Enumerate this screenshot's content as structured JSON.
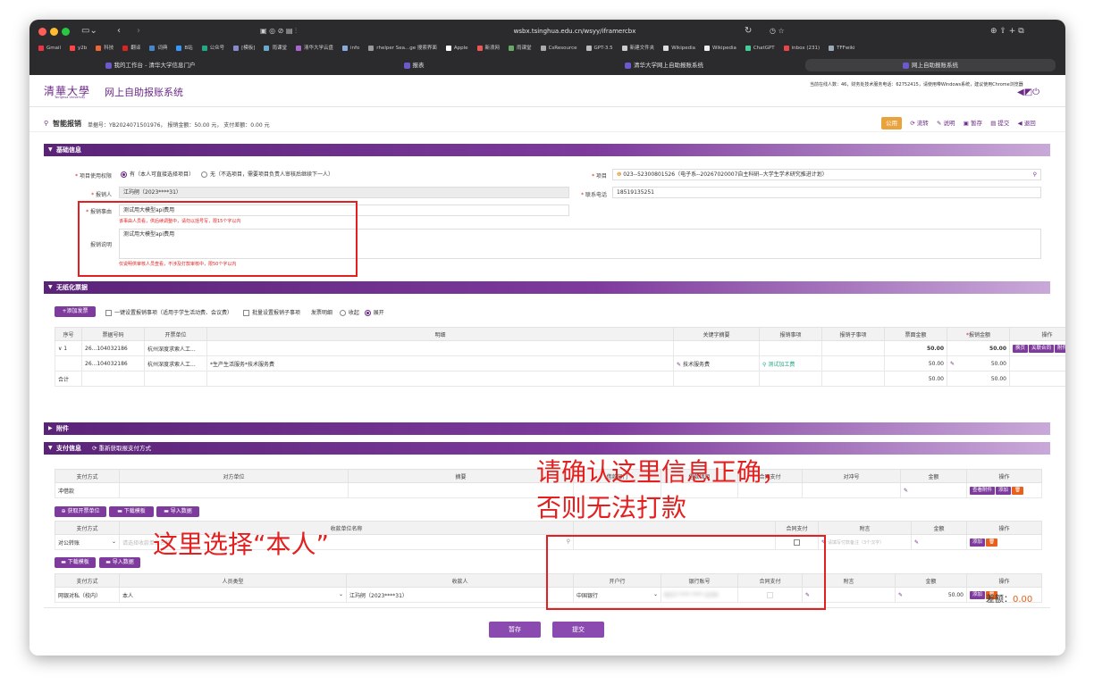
{
  "browser": {
    "url": "wsbx.tsinghua.edu.cn/wsyy/iframercbx",
    "bookmarks": [
      "Gmail",
      "y2b",
      "科技",
      "翻译",
      "词典",
      "B站",
      "公众号",
      "[模板]",
      "雨课堂",
      "清华大学云盘",
      "info",
      "rhelper Sea...ge 搜索界面",
      "Apple",
      "新浪网",
      "雨课堂",
      "CsResource",
      "GPT-3.5",
      "新建文件夹",
      "Wikipedia",
      "Wikipedia",
      "ChatGPT",
      "inbox (231)",
      "TFFwiki"
    ],
    "tabs": [
      "我的工作台 - 清华大学信息门户",
      "报表",
      "清华大学网上自助报账系统",
      "网上自助报账系统"
    ]
  },
  "header": {
    "logo": "清華大學",
    "logo_sub": "Tsinghua University",
    "title": "网上自助报账系统",
    "userinfo": "当前在线人数：46，财务处技术服务电话：62752415，请使用带Windows系统，建议使用Chrome浏览器"
  },
  "bar": {
    "title": "智能报销",
    "meta": "单据号：YB2024071501976，  报销金额：50.00 元，  支付差额：0.00 元",
    "buttons": [
      "公用",
      "流转",
      "说明",
      "暂存",
      "提交",
      "退回"
    ]
  },
  "basic": {
    "section_title": "基础信息",
    "project_usage_label": "项目使用权限",
    "project_usage_opt1": "有（本人可直接选择项目）",
    "project_usage_opt2": "无（不选项目，需要项目负责人审核后继续下一人）",
    "project_label": "项目",
    "project_value": "023--52300801526（电子系--20267020007自主科研--大学生学术研究推进计划）",
    "reporter_label": "报销人",
    "reporter_value": "江玙舸（2023****31）",
    "phone_label": "联系电话",
    "phone_value": "18519135251",
    "reason_label": "报销事由",
    "reason_value": "测试用大模型api费用",
    "reason_hint": "该事由人员看，供后续调整中，请勿以括号写，限15个字以内",
    "desc_label": "报销说明",
    "desc_value": "测试用大模型api费用",
    "desc_hint": "仅说明供审核人员查看，不涉及打款审核中，限50个字以内"
  },
  "invoice": {
    "section_title": "无纸化票据",
    "add_btn": "+添加发票",
    "chk1": "一键设置报销事项（适用于学生活动费、会议费）",
    "chk2": "批量设置报销子事项",
    "detail_label": "发票明细",
    "collapse": "收起",
    "expand": "展开",
    "headers": [
      "序号",
      "票据号码",
      "开票单位",
      "明细",
      "关键字摘要",
      "报销事项",
      "报销子事项",
      "票面金额",
      "报销金额",
      "操作"
    ],
    "rows": [
      {
        "no": "∨ 1",
        "num": "26...104032186",
        "unit": "杭州深度求索人工...",
        "detail": "",
        "keyword": "",
        "item": "",
        "subitem": "",
        "amt": "50.00",
        "reimb": "50.00",
        "ops": [
          "换页",
          "关联合同",
          "附件"
        ]
      },
      {
        "no": "",
        "num": "26...104032186",
        "unit": "杭州深度求索人工...",
        "detail": "*生产生活服务*技术服务费",
        "keyword": "技术服务费",
        "item": "测试加工费",
        "subitem": "",
        "amt": "50.00",
        "reimb": "50.00",
        "ops": []
      }
    ],
    "total_label": "合计",
    "total_amt": "50.00",
    "total_reimb": "50.00"
  },
  "attach": {
    "section_title": "附件"
  },
  "payment": {
    "section_title": "支付信息",
    "refetch": "重新获取报支付方式",
    "t1_headers": [
      "支付方式",
      "对方单位",
      "摘要",
      "借款部门",
      "借款项目",
      "合同支付",
      "对冲号",
      "金额",
      "操作"
    ],
    "t1_row": {
      "method": "冲借款",
      "ops": [
        "查看附件",
        "添加"
      ]
    },
    "btn_fetch": "获取开票单位",
    "btn_download": "下载模板",
    "btn_import": "导入数据",
    "t2_headers": [
      "支付方式",
      "收款单位名称",
      "",
      "合同支付",
      "附言",
      "金额",
      "操作"
    ],
    "t2_row": {
      "method": "对公转账",
      "placeholder": "请选择收款单位名称",
      "note_ph": "请填写付款备注（3个汉字）",
      "ops": [
        "添加"
      ]
    },
    "btn_download2": "下载模板",
    "btn_import2": "导入数据",
    "t3_headers": [
      "支付方式",
      "人员类型",
      "收款人",
      "开户行",
      "银行账号",
      "合同支付",
      "附言",
      "金额",
      "操作"
    ],
    "t3_row": {
      "method": "网银对私（校内）",
      "person_type": "本人",
      "payee": "江玙舸（2023****31）",
      "bank": "中国银行",
      "account": "6217 **** **** 1234",
      "amount": "50.00",
      "ops": [
        "添加"
      ]
    },
    "diff_label": "差额：",
    "diff_value": "0.00"
  },
  "footer": {
    "save": "暂存",
    "submit": "提交"
  },
  "annotations": {
    "a1": "请确认这里信息正确，",
    "a2": "否则无法打款",
    "a3": "这里选择“本人”"
  }
}
